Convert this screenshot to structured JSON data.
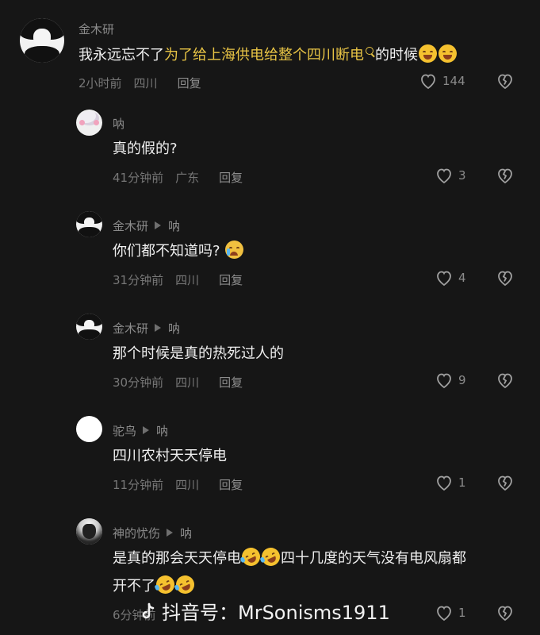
{
  "comments": [
    {
      "username": "金木研",
      "reply_to": "",
      "text_pre": "我永远忘不了",
      "text_highlight": "为了给上海供电给整个四川断电",
      "text_post": "的时候",
      "time": "2小时前",
      "location": "四川",
      "reply_label": "回复",
      "likes": "144"
    },
    {
      "username": "呐",
      "text": "真的假的?",
      "time": "41分钟前",
      "location": "广东",
      "reply_label": "回复",
      "likes": "3"
    },
    {
      "username": "金木研",
      "reply_to": "呐",
      "text": "你们都不知道吗?",
      "time": "31分钟前",
      "location": "四川",
      "reply_label": "回复",
      "likes": "4"
    },
    {
      "username": "金木研",
      "reply_to": "呐",
      "text": "那个时候是真的热死过人的",
      "time": "30分钟前",
      "location": "四川",
      "reply_label": "回复",
      "likes": "9"
    },
    {
      "username": "驼鸟",
      "reply_to": "呐",
      "text": "四川农村天天停电",
      "time": "11分钟前",
      "location": "四川",
      "reply_label": "回复",
      "likes": "1"
    },
    {
      "username": "神的忧伤",
      "reply_to": "呐",
      "text_line1_a": "是真的那会天天停电",
      "text_line1_b": "四十几度的天气没有电风扇都",
      "text_line2": "开不了",
      "time": "6分钟前",
      "likes": "1"
    }
  ],
  "watermark": {
    "text": "抖音号：MrSonisms1911",
    "icon": "douyin-logo-icon"
  },
  "icons": {
    "like": "heart-outline-icon",
    "dislike": "broken-heart-icon",
    "search": "search-icon"
  },
  "colors": {
    "background": "#161616",
    "highlight": "#e8c445",
    "muted": "#8b8b8b"
  }
}
